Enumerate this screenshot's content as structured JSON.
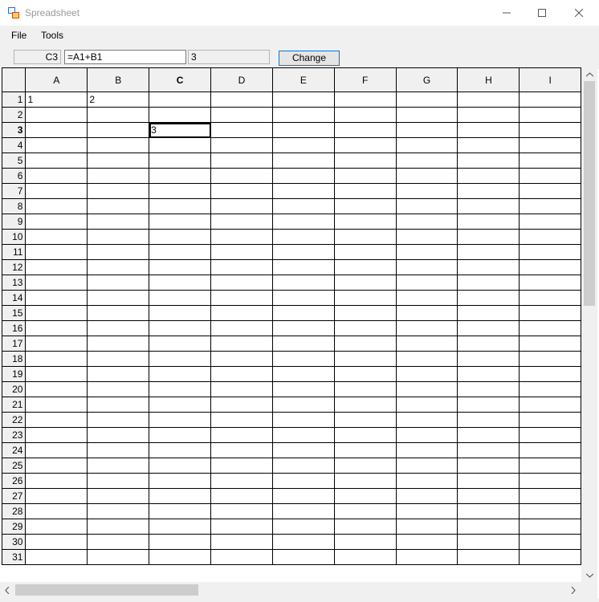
{
  "window": {
    "title": "Spreadsheet"
  },
  "menu": {
    "file": "File",
    "tools": "Tools"
  },
  "toolbar": {
    "cell_name": "C3",
    "formula": "=A1+B1",
    "value": "3",
    "change_label": "Change"
  },
  "grid": {
    "columns": [
      "A",
      "B",
      "C",
      "D",
      "E",
      "F",
      "G",
      "H",
      "I"
    ],
    "active_column": "C",
    "active_row": "3",
    "rows": [
      {
        "num": "1",
        "cells": [
          "1",
          "2",
          "",
          "",
          "",
          "",
          "",
          "",
          ""
        ]
      },
      {
        "num": "2",
        "cells": [
          "",
          "",
          "",
          "",
          "",
          "",
          "",
          "",
          ""
        ]
      },
      {
        "num": "3",
        "cells": [
          "",
          "",
          "3",
          "",
          "",
          "",
          "",
          "",
          ""
        ]
      },
      {
        "num": "4",
        "cells": [
          "",
          "",
          "",
          "",
          "",
          "",
          "",
          "",
          ""
        ]
      },
      {
        "num": "5",
        "cells": [
          "",
          "",
          "",
          "",
          "",
          "",
          "",
          "",
          ""
        ]
      },
      {
        "num": "6",
        "cells": [
          "",
          "",
          "",
          "",
          "",
          "",
          "",
          "",
          ""
        ]
      },
      {
        "num": "7",
        "cells": [
          "",
          "",
          "",
          "",
          "",
          "",
          "",
          "",
          ""
        ]
      },
      {
        "num": "8",
        "cells": [
          "",
          "",
          "",
          "",
          "",
          "",
          "",
          "",
          ""
        ]
      },
      {
        "num": "9",
        "cells": [
          "",
          "",
          "",
          "",
          "",
          "",
          "",
          "",
          ""
        ]
      },
      {
        "num": "10",
        "cells": [
          "",
          "",
          "",
          "",
          "",
          "",
          "",
          "",
          ""
        ]
      },
      {
        "num": "11",
        "cells": [
          "",
          "",
          "",
          "",
          "",
          "",
          "",
          "",
          ""
        ]
      },
      {
        "num": "12",
        "cells": [
          "",
          "",
          "",
          "",
          "",
          "",
          "",
          "",
          ""
        ]
      },
      {
        "num": "13",
        "cells": [
          "",
          "",
          "",
          "",
          "",
          "",
          "",
          "",
          ""
        ]
      },
      {
        "num": "14",
        "cells": [
          "",
          "",
          "",
          "",
          "",
          "",
          "",
          "",
          ""
        ]
      },
      {
        "num": "15",
        "cells": [
          "",
          "",
          "",
          "",
          "",
          "",
          "",
          "",
          ""
        ]
      },
      {
        "num": "16",
        "cells": [
          "",
          "",
          "",
          "",
          "",
          "",
          "",
          "",
          ""
        ]
      },
      {
        "num": "17",
        "cells": [
          "",
          "",
          "",
          "",
          "",
          "",
          "",
          "",
          ""
        ]
      },
      {
        "num": "18",
        "cells": [
          "",
          "",
          "",
          "",
          "",
          "",
          "",
          "",
          ""
        ]
      },
      {
        "num": "19",
        "cells": [
          "",
          "",
          "",
          "",
          "",
          "",
          "",
          "",
          ""
        ]
      },
      {
        "num": "20",
        "cells": [
          "",
          "",
          "",
          "",
          "",
          "",
          "",
          "",
          ""
        ]
      },
      {
        "num": "21",
        "cells": [
          "",
          "",
          "",
          "",
          "",
          "",
          "",
          "",
          ""
        ]
      },
      {
        "num": "22",
        "cells": [
          "",
          "",
          "",
          "",
          "",
          "",
          "",
          "",
          ""
        ]
      },
      {
        "num": "23",
        "cells": [
          "",
          "",
          "",
          "",
          "",
          "",
          "",
          "",
          ""
        ]
      },
      {
        "num": "24",
        "cells": [
          "",
          "",
          "",
          "",
          "",
          "",
          "",
          "",
          ""
        ]
      },
      {
        "num": "25",
        "cells": [
          "",
          "",
          "",
          "",
          "",
          "",
          "",
          "",
          ""
        ]
      },
      {
        "num": "26",
        "cells": [
          "",
          "",
          "",
          "",
          "",
          "",
          "",
          "",
          ""
        ]
      },
      {
        "num": "27",
        "cells": [
          "",
          "",
          "",
          "",
          "",
          "",
          "",
          "",
          ""
        ]
      },
      {
        "num": "28",
        "cells": [
          "",
          "",
          "",
          "",
          "",
          "",
          "",
          "",
          ""
        ]
      },
      {
        "num": "29",
        "cells": [
          "",
          "",
          "",
          "",
          "",
          "",
          "",
          "",
          ""
        ]
      },
      {
        "num": "30",
        "cells": [
          "",
          "",
          "",
          "",
          "",
          "",
          "",
          "",
          ""
        ]
      },
      {
        "num": "31",
        "cells": [
          "",
          "",
          "",
          "",
          "",
          "",
          "",
          "",
          ""
        ]
      }
    ]
  },
  "icons": {
    "app": "spreadsheet-app-icon",
    "minimize": "minimize-icon",
    "maximize": "maximize-icon",
    "close": "close-icon",
    "scroll_up": "chevron-up-icon",
    "scroll_down": "chevron-down-icon",
    "scroll_left": "chevron-left-icon",
    "scroll_right": "chevron-right-icon"
  },
  "colors": {
    "accent": "#0078d7",
    "chrome": "#f0f0f0",
    "title_text": "#9a9a9a"
  }
}
